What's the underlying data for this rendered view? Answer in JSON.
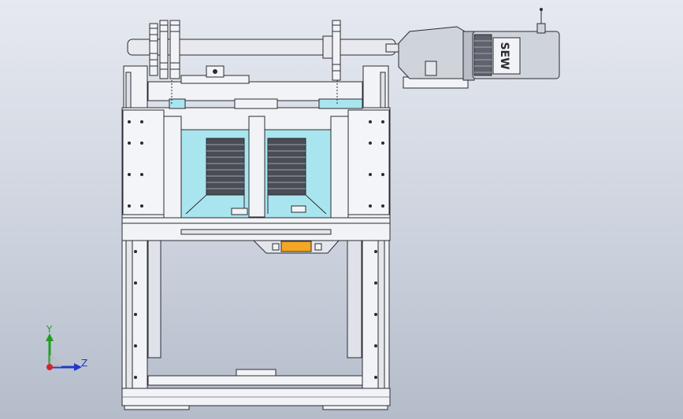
{
  "viewport": {
    "name": "cad-graphics-area",
    "background_top": "#e6e9f0",
    "background_bottom": "#b4bcca"
  },
  "model": {
    "motor_brand_text": "SEW",
    "colors": {
      "frame": "#f2f3f6",
      "outline": "#2a2c33",
      "glass": "#a9e5ef",
      "shaft": "#e7e9ee",
      "motor_body": "#cfd3da",
      "motor_fins": "#5e636d",
      "accent_handle": "#f5a623",
      "slot_dark": "#4a4d55"
    }
  },
  "triad": {
    "y_label": "Y",
    "z_label": "Z",
    "y_color": "#1f9d1f",
    "z_color": "#2437c9",
    "origin_color": "#d4232a"
  }
}
